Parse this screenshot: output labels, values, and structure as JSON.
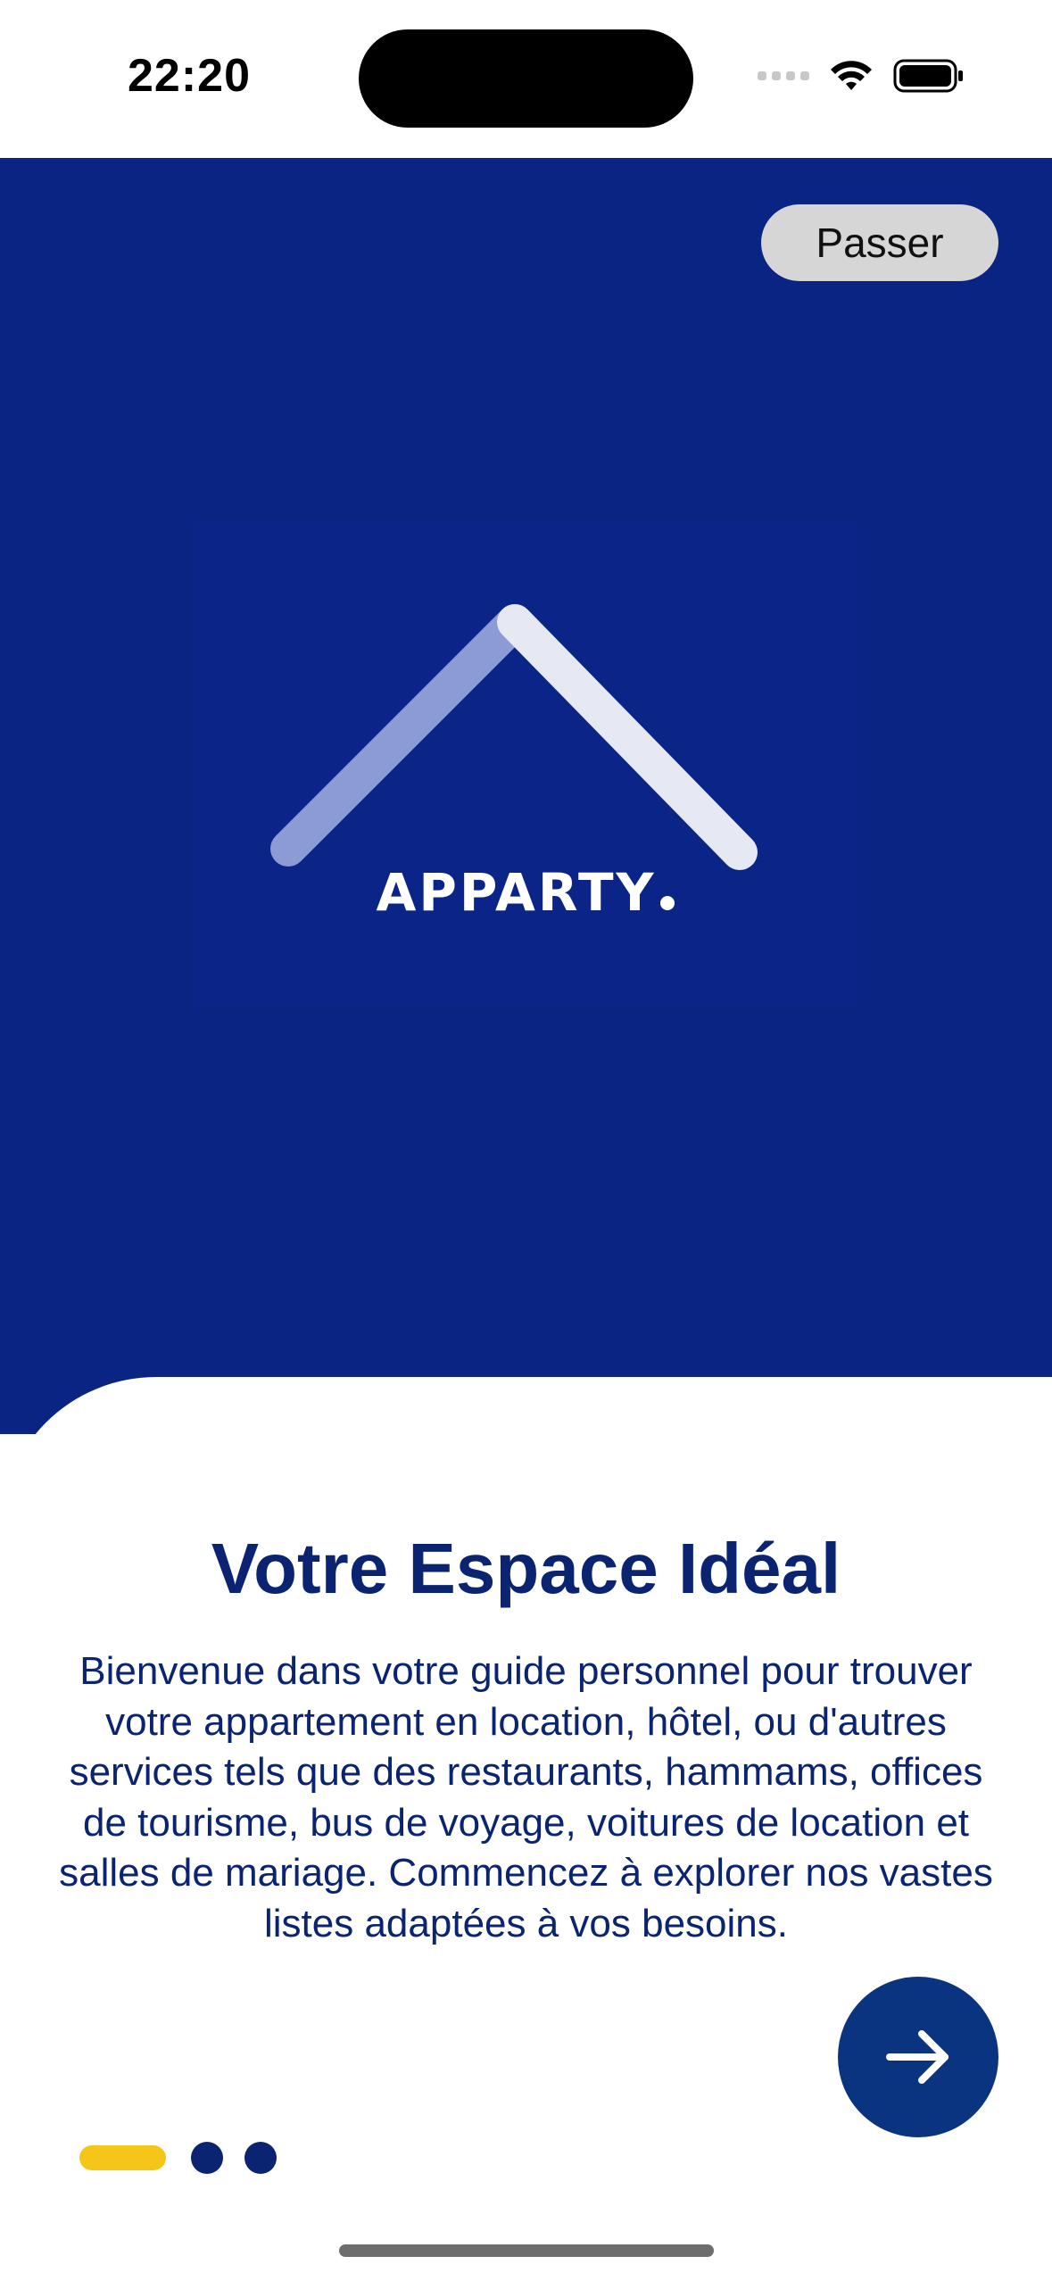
{
  "status_bar": {
    "time": "22:20",
    "icons": [
      "cellular-signal-icon",
      "wifi-icon",
      "battery-icon"
    ]
  },
  "onboarding": {
    "skip_label": "Passer",
    "brand_name": "APPARTY",
    "title": "Votre Espace Idéal",
    "description": "Bienvenue dans votre guide personnel pour trouver votre appartement en location, hôtel, ou d'autres services tels que des restaurants, hammams, offices de tourisme, bus de voyage, voitures de location et salles de mariage. Commencez à explorer nos vastes listes adaptées à vos besoins.",
    "next_icon": "arrow-right-icon",
    "pager": {
      "pages": 3,
      "current": 1
    }
  },
  "colors": {
    "hero_background": "#0a2484",
    "primary_text": "#0a2472",
    "accent_indicator": "#f5c518",
    "next_button": "#0a347f",
    "skip_button": "#d6d6d6"
  }
}
